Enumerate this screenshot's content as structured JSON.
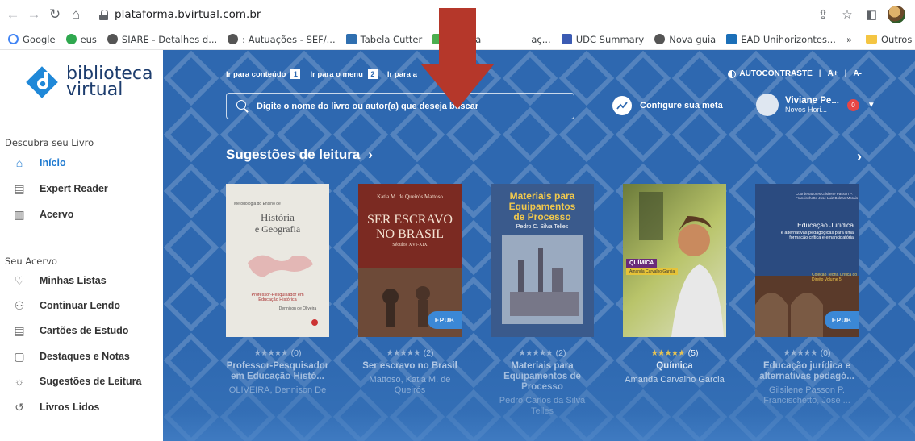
{
  "browser": {
    "url": "plataforma.bvirtual.com.br",
    "bookmarks": [
      {
        "label": "Google",
        "color": "#4285f4"
      },
      {
        "label": "eus",
        "color": "#2fa84f"
      },
      {
        "label": "SIARE - Detalhes d...",
        "color": "#555555"
      },
      {
        "label": ": Autuações - SEF/...",
        "color": "#555555"
      },
      {
        "label": "Tabela Cutter",
        "color": "#2f6fb0"
      },
      {
        "label": "Ciência",
        "color": "#4caf50"
      },
      {
        "label": "UDC Summary",
        "color": "#3b5bb3"
      },
      {
        "label": "Nova guia",
        "color": "#555555"
      },
      {
        "label": "EAD Unihorizontes...",
        "color": "#1b6fb8"
      }
    ],
    "bookmark_other": "Outros favorit",
    "bookmark_more": "»",
    "bookmark_partial": "aç..."
  },
  "sidebar": {
    "logo_line1": "biblioteca",
    "logo_line2": "virtual",
    "section1": "Descubra seu Livro",
    "items1": [
      {
        "label": "Início",
        "icon": "home-icon"
      },
      {
        "label": "Expert Reader",
        "icon": "document-icon"
      },
      {
        "label": "Acervo",
        "icon": "books-icon"
      }
    ],
    "section2": "Seu Acervo",
    "items2": [
      {
        "label": "Minhas Listas",
        "icon": "heart-icon"
      },
      {
        "label": "Continuar Lendo",
        "icon": "reading-icon"
      },
      {
        "label": "Cartões de Estudo",
        "icon": "card-icon"
      },
      {
        "label": "Destaques e Notas",
        "icon": "note-icon"
      },
      {
        "label": "Sugestões de Leitura",
        "icon": "bulb-icon"
      },
      {
        "label": "Livros Lidos",
        "icon": "history-icon"
      }
    ]
  },
  "header": {
    "skip_content": "Ir para conteúdo",
    "skip_content_num": "1",
    "skip_menu": "Ir para o menu",
    "skip_menu_num": "2",
    "skip_other": "Ir para a",
    "autocontrast": "AUTOCONTRASTE",
    "font_plus": "A+",
    "font_minus": "A-",
    "search_placeholder": "Digite o nome do livro ou autor(a) que deseja buscar",
    "meta_label": "Configure sua meta",
    "user_name": "Viviane Pe...",
    "user_org": "Novos Hori...",
    "notifications": "0"
  },
  "main": {
    "section_title": "Sugestões de leitura",
    "books": [
      {
        "rating_count": "(0)",
        "stars": 0,
        "title": "Professor-Pesquisador em Educação Histó...",
        "author": "OLIVEIRA, Dennison De",
        "cover_line1": "História",
        "cover_line2": "e Geografia",
        "cover_small": "Professor-Pesquisador em Educação Histórica",
        "cover_top": "Metodologia do Ensino de",
        "cover_author": "Dennison de Oliveira",
        "epub": ""
      },
      {
        "rating_count": "(2)",
        "stars": 0,
        "title": "Ser escravo no Brasil",
        "author": "Mattoso, Katia M. de Queirós",
        "cover_author": "Katia M. de Queirós Mattoso",
        "cover_line1": "SER ESCRAVO",
        "cover_line2": "NO BRASIL",
        "cover_small": "Séculos XVI-XIX",
        "epub": "EPUB"
      },
      {
        "rating_count": "(2)",
        "stars": 0,
        "title": "Materiais para Equipamentos de Processo",
        "author": "Pedro Carlos da Silva Telles",
        "cover_line1": "Materiais para",
        "cover_line2": "Equipamentos",
        "cover_line3": "de Processo",
        "cover_author": "Pedro C. Silva Telles",
        "epub": ""
      },
      {
        "rating_count": "(5)",
        "stars": 5,
        "title": "Química",
        "author": "Amanda Carvalho Garcia",
        "cover_line1": "QUÍMICA",
        "cover_author": "Amanda Carvalho Garcia",
        "epub": ""
      },
      {
        "rating_count": "(0)",
        "stars": 0,
        "title": "Educação jurídica e alternativas pedagó...",
        "author": "Gilsilene Passon P. Francischetto, José ...",
        "cover_top": "Coordenadores Gilsilene Passon P. Francischetto José Luiz Bolzan Morais",
        "cover_line1": "Educação Jurídica",
        "cover_small": "e alternativas pedagógicas para uma formação crítica e emancipatória",
        "cover_series": "Coleção Teoria Crítica do Direito Volume 5",
        "epub": "EPUB"
      }
    ]
  },
  "colors": {
    "main_bg": "#2e68b0",
    "accent": "#1f7ad0",
    "annotation_arrow": "#b5372a",
    "star_active": "#f2c94c"
  }
}
